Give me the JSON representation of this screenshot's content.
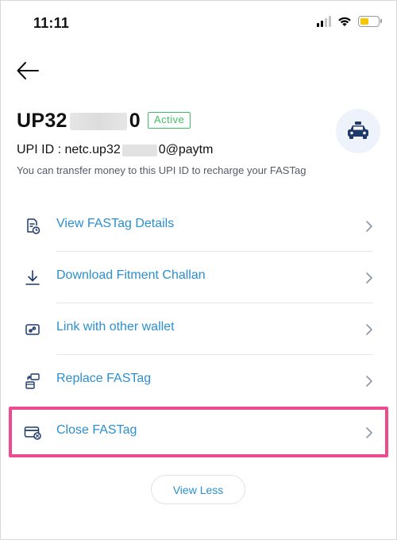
{
  "status_bar": {
    "time": "11:11"
  },
  "vehicle": {
    "number_prefix": "UP32",
    "number_suffix": "0",
    "status_badge": "Active",
    "upi_prefix": "UPI ID : netc.up32",
    "upi_suffix": "0@paytm",
    "upi_note": "You can transfer money to this UPI ID to recharge your FASTag"
  },
  "menu": {
    "items": [
      {
        "label": "View FASTag Details",
        "icon": "document-clock-icon"
      },
      {
        "label": "Download Fitment Challan",
        "icon": "download-icon"
      },
      {
        "label": "Link with other wallet",
        "icon": "wallet-link-icon"
      },
      {
        "label": "Replace FASTag",
        "icon": "replace-card-icon"
      },
      {
        "label": "Close FASTag",
        "icon": "card-close-icon"
      }
    ]
  },
  "footer": {
    "view_less_label": "View Less"
  },
  "colors": {
    "accent": "#2b8fd0",
    "active_green": "#3fbf63",
    "highlight_pink": "#ec4c8f",
    "icon_navy": "#1d3a6b"
  }
}
